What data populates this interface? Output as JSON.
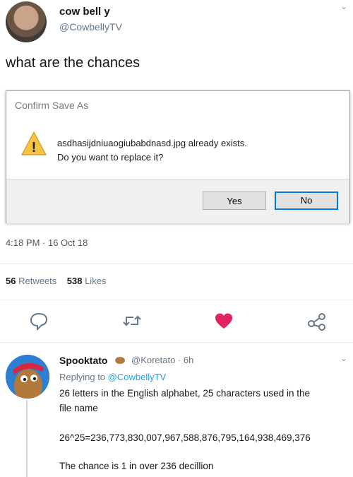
{
  "tweet": {
    "display_name": "cow bell y",
    "handle": "@CowbellyTV",
    "text": "what are the chances",
    "timestamp": "4:18 PM · 16 Oct 18",
    "retweets_count": "56",
    "retweets_label": "Retweets",
    "likes_count": "538",
    "likes_label": "Likes",
    "chevron": "⌄"
  },
  "dialog": {
    "title": "Confirm Save As",
    "message_line1": "asdhasijdniuaogiubabdnasd.jpg already exists.",
    "message_line2": "Do you want to replace it?",
    "yes_label": "Yes",
    "no_label": "No",
    "warning_glyph": "!"
  },
  "reply": {
    "display_name": "Spooktato",
    "handle_time": "@Koretato · 6h",
    "replying_prefix": "Replying to",
    "replying_to": "@CowbellyTV",
    "line1": "26 letters in the English alphabet, 25 characters used in the",
    "line2": "file name",
    "line3": "26^25=236,773,830,007,967,588,876,795,164,938,469,376",
    "line4": "The chance is 1 in over 236 decillion",
    "chevron": "⌄"
  },
  "icons": {
    "reply": "reply-icon",
    "retweet": "retweet-icon",
    "like": "heart-icon",
    "share": "share-icon",
    "warning": "warning-icon"
  },
  "colors": {
    "like": "#e0245e",
    "link": "#1da1f2",
    "dialog_default_border": "#0078d7"
  }
}
